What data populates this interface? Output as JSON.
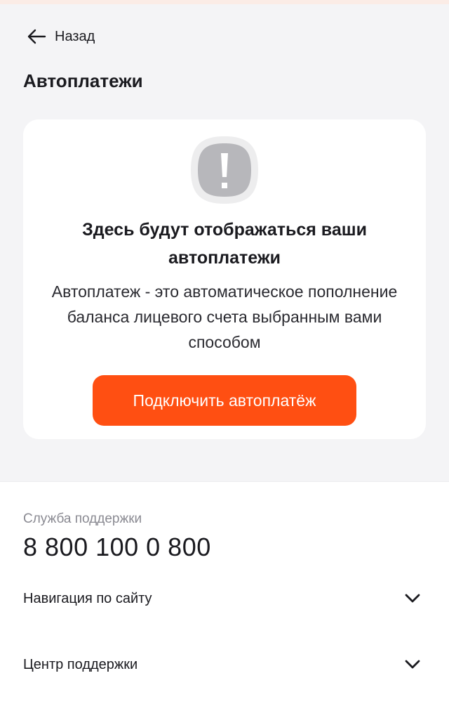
{
  "header": {
    "back_label": "Назад",
    "page_title": "Автоплатежи"
  },
  "empty_state": {
    "icon": "warning-icon",
    "title": "Здесь будут отображаться ваши автоплатежи",
    "description": "Автоплатеж - это автоматическое пополнение баланса лицевого счета выбранным вами способом",
    "button_label": "Подключить автоплатёж"
  },
  "footer": {
    "support_label": "Служба поддержки",
    "support_phone": "8 800 100 0 800",
    "sections": [
      {
        "label": "Навигация по сайту",
        "icon": "chevron-down-icon"
      },
      {
        "label": "Центр поддержки",
        "icon": "chevron-down-icon"
      }
    ]
  },
  "colors": {
    "accent": "#ff4f12",
    "background": "#f4f4f6",
    "card": "#ffffff",
    "icon_gray": "#b7b7bb"
  }
}
